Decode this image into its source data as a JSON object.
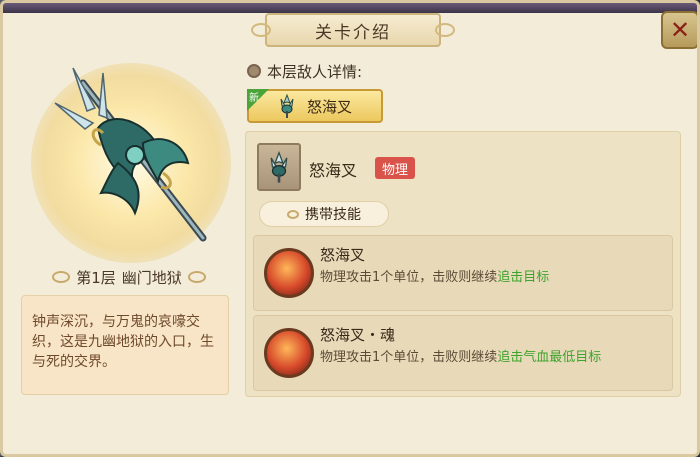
{
  "title": "关卡介绍",
  "close_icon": "close-x",
  "floor": {
    "label": "第1层",
    "name": "幽门地狱"
  },
  "description": "钟声深沉，与万鬼的哀嚎交织，这是九幽地狱的入口，生与死的交界。",
  "enemy_section_label": "本层敌人详情:",
  "enemy_tab": {
    "badge": "新",
    "name": "怒海叉"
  },
  "enemy": {
    "name": "怒海叉",
    "type": "物理"
  },
  "skills_label": "携带技能",
  "skills": [
    {
      "name": "怒海叉",
      "desc_plain": "物理攻击1个单位，击败则继续",
      "desc_highlight": "追击目标"
    },
    {
      "name": "怒海叉・魂",
      "desc_plain": "物理攻击1个单位，击败则继续",
      "desc_highlight": "追击气血最低目标"
    }
  ],
  "colors": {
    "accent_green": "#3ea32f",
    "badge_red": "#d9534a",
    "panel_bg": "#f3ecd9"
  }
}
